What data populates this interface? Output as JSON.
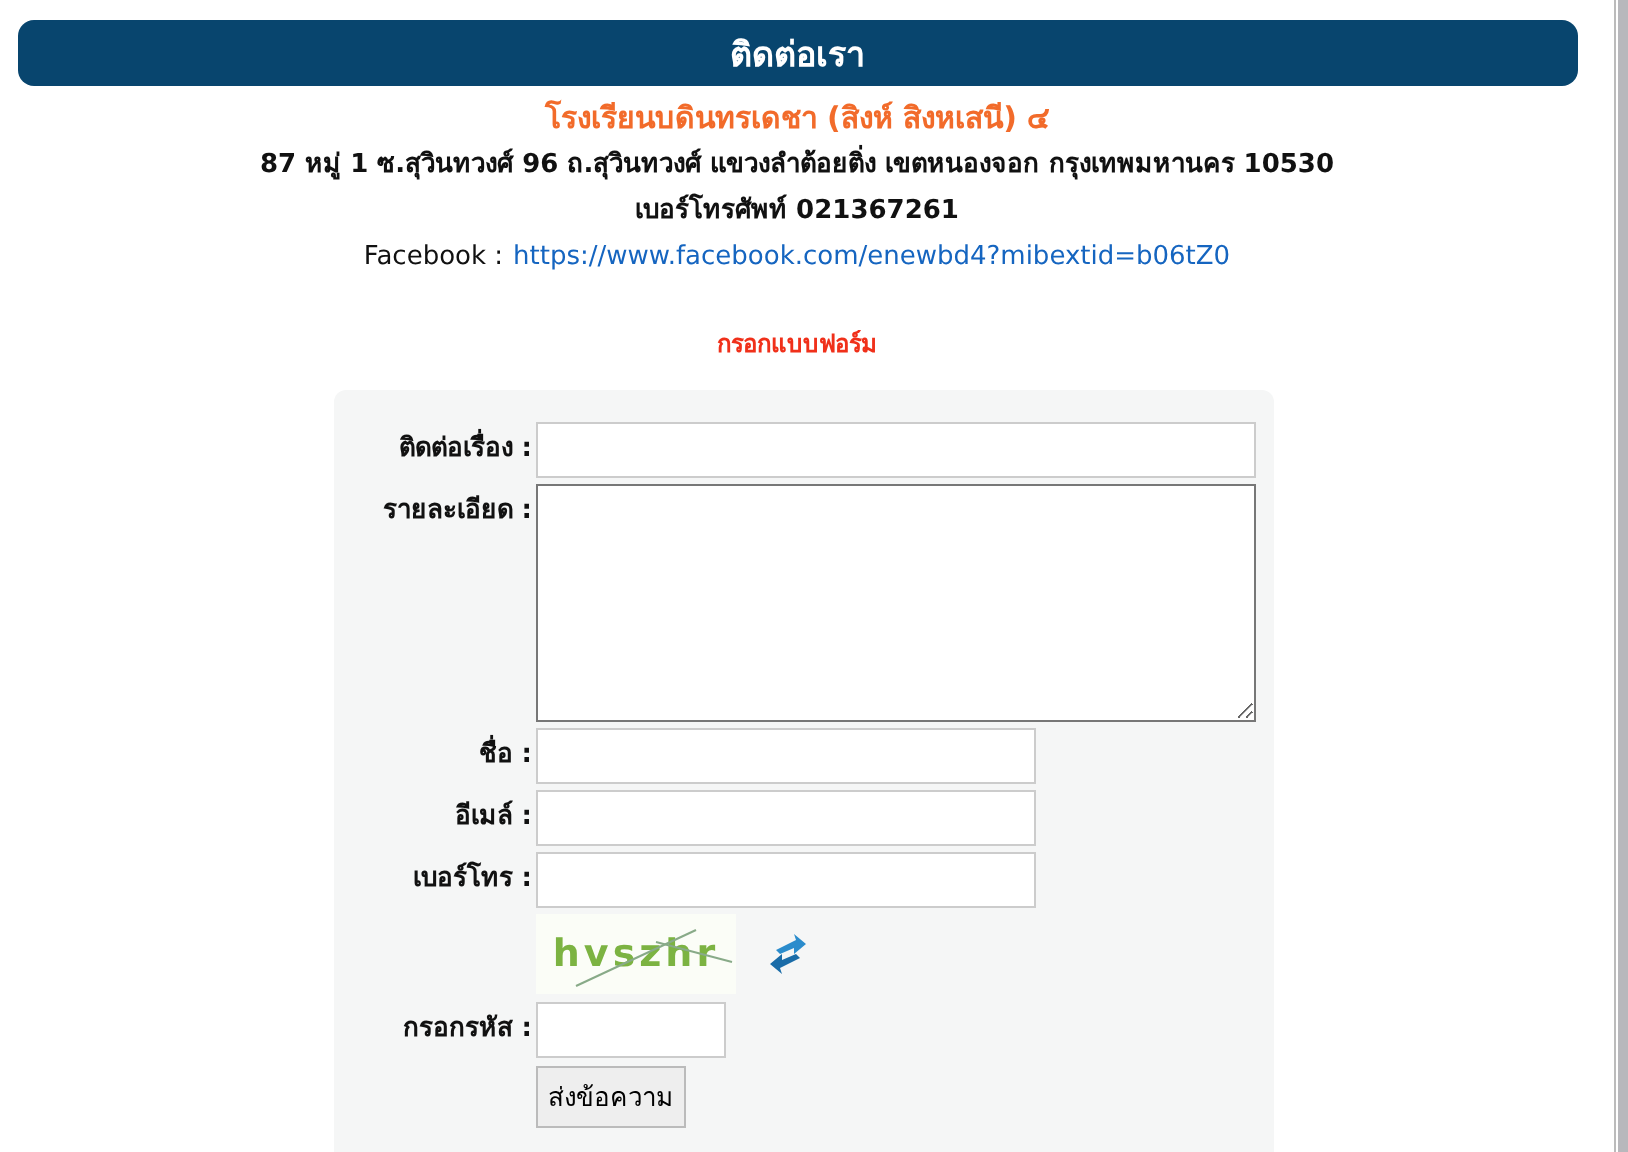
{
  "header": {
    "title": "ติดต่อเรา"
  },
  "school": {
    "name": "โรงเรียนบดินทรเดชา (สิงห์ สิงหเสนี) ๔",
    "address": "87 หมู่ 1 ซ.สุวินทวงศ์ 96 ถ.สุวินทวงศ์   แขวงลำต้อยติ่ง  เขตหนองจอก กรุงเทพมหานคร 10530",
    "phone": "เบอร์โทรศัพท์ 021367261",
    "facebook_label": "Facebook :",
    "facebook_link": "https://www.facebook.com/enewbd4?mibextid=b06tZ0"
  },
  "form": {
    "heading": "กรอกแบบฟอร์ม",
    "fields": [
      {
        "label": "ติดต่อเรื่อง :",
        "kind": "wide"
      },
      {
        "label": "รายละเอียด :",
        "kind": "textarea"
      },
      {
        "label": "ชื่อ :",
        "kind": "medium"
      },
      {
        "label": "อีเมล์ :",
        "kind": "medium"
      },
      {
        "label": "เบอร์โทร :",
        "kind": "medium"
      }
    ],
    "captcha": {
      "text": "hvszhr"
    },
    "code_label": "กรอกรหัส :",
    "submit": "ส่งข้อความ"
  }
}
